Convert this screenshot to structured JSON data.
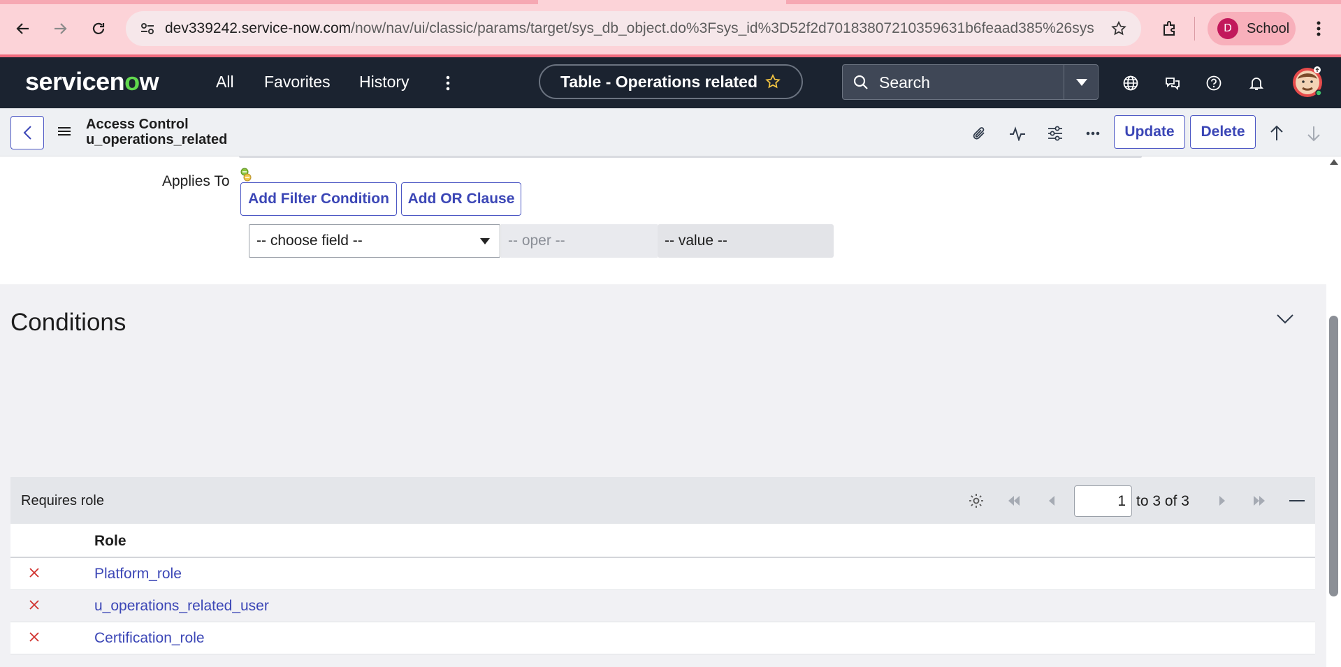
{
  "browser": {
    "url_host": "dev339242.service-now.com",
    "url_path": "/now/nav/ui/classic/params/target/sys_db_object.do%3Fsys_id%3D52f2d70183807210359631b6feaad385%26sys...",
    "profile_initial": "D",
    "profile_name": "School"
  },
  "header": {
    "logo_prefix": "servicen",
    "logo_o": "o",
    "logo_suffix": "w",
    "nav": {
      "all": "All",
      "favorites": "Favorites",
      "history": "History"
    },
    "context_title": "Table - Operations related",
    "search_placeholder": "Search"
  },
  "form_header": {
    "title_line1": "Access Control",
    "title_line2": "u_operations_related",
    "update_label": "Update",
    "delete_label": "Delete"
  },
  "form": {
    "applies_to_label": "Applies To",
    "add_filter_label": "Add Filter Condition",
    "add_or_label": "Add OR Clause",
    "field_select": "-- choose field --",
    "oper_placeholder": "-- oper --",
    "value_placeholder": "-- value --"
  },
  "conditions": {
    "title": "Conditions"
  },
  "requires_role": {
    "title": "Requires role",
    "page_value": "1",
    "page_range": "to 3 of 3",
    "column_role": "Role",
    "rows": [
      {
        "role": "Platform_role"
      },
      {
        "role": "u_operations_related_user"
      },
      {
        "role": "Certification_role"
      }
    ]
  },
  "colors": {
    "accent": "#3b46b6",
    "nav_bg": "#1b2330",
    "logo_green": "#62d84e",
    "delete_red": "#d0312d"
  }
}
